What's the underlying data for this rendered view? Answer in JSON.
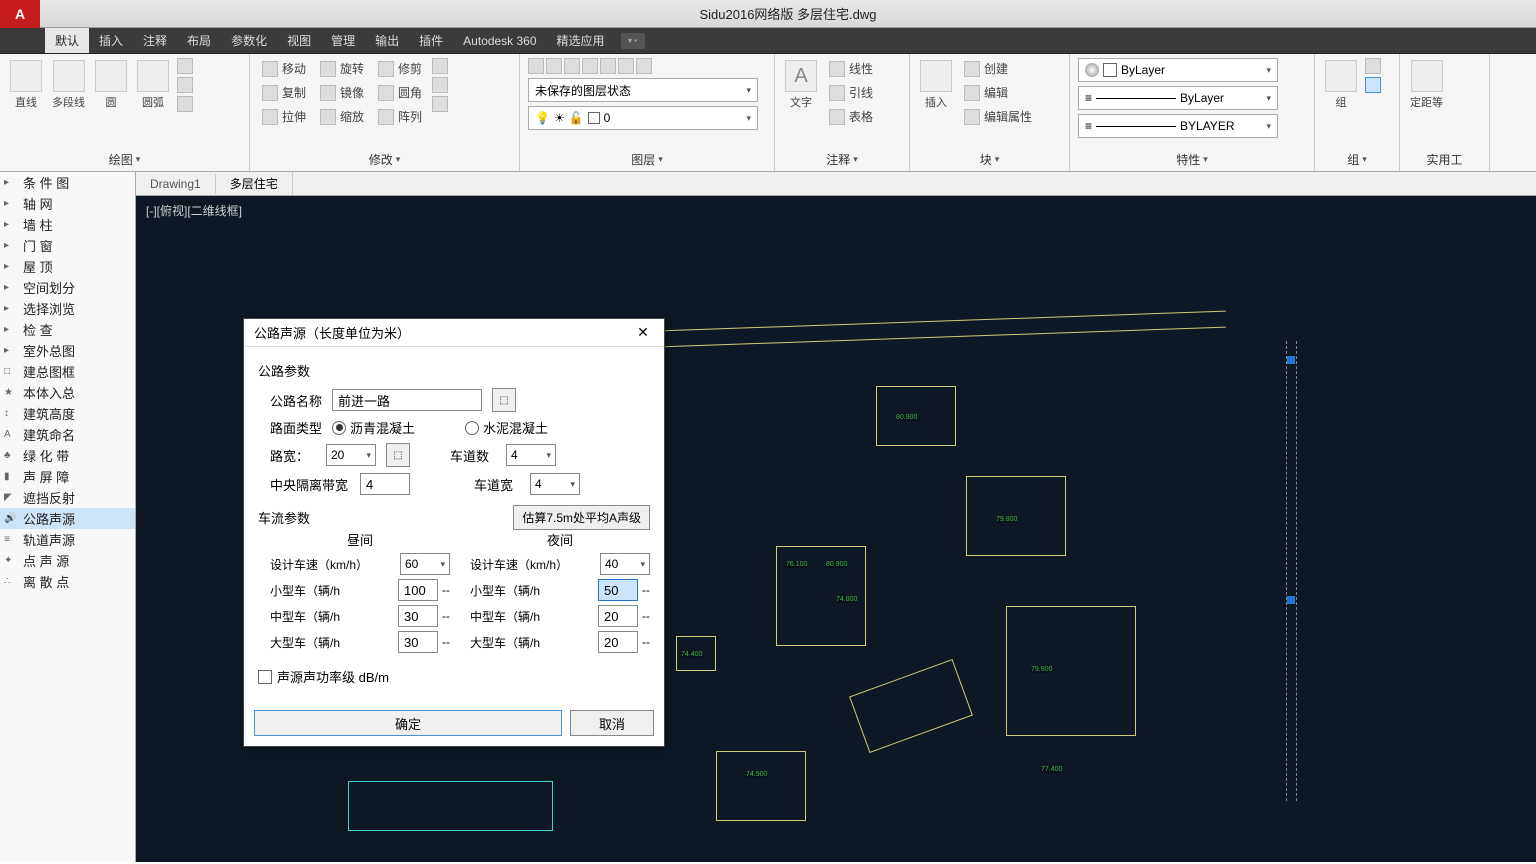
{
  "app": {
    "logo": "A",
    "title": "Sidu2016网络版   多层住宅.dwg"
  },
  "menu": {
    "items": [
      "默认",
      "插入",
      "注释",
      "布局",
      "参数化",
      "视图",
      "管理",
      "输出",
      "插件",
      "Autodesk 360",
      "精选应用"
    ]
  },
  "ribbon": {
    "draw": {
      "label": "绘图",
      "items": [
        "直线",
        "多段线",
        "圆",
        "圆弧"
      ]
    },
    "modify": {
      "label": "修改",
      "items": [
        "移动",
        "旋转",
        "修剪",
        "复制",
        "镜像",
        "圆角",
        "拉伸",
        "缩放",
        "阵列"
      ]
    },
    "layer": {
      "label": "图层",
      "unsaved": "未保存的图层状态",
      "current": "0"
    },
    "annot": {
      "label": "注释",
      "items": [
        "文字",
        "线性",
        "引线",
        "表格"
      ]
    },
    "block": {
      "label": "块",
      "items": [
        "插入",
        "创建",
        "编辑",
        "编辑属性"
      ]
    },
    "props": {
      "label": "特性",
      "bylayer": "ByLayer",
      "bylayer2": "ByLayer",
      "bylayer3": "BYLAYER"
    },
    "group": {
      "label": "组",
      "item": "组"
    },
    "util": {
      "label": "实用工",
      "item": "定距等"
    }
  },
  "sidebar": {
    "items": [
      {
        "ico": "▸",
        "label": "条 件 图"
      },
      {
        "ico": "▸",
        "label": "轴      网"
      },
      {
        "ico": "▸",
        "label": "墙      柱"
      },
      {
        "ico": "▸",
        "label": "门      窗"
      },
      {
        "ico": "▸",
        "label": "屋      顶"
      },
      {
        "ico": "▸",
        "label": "空间划分"
      },
      {
        "ico": "▸",
        "label": "选择浏览"
      },
      {
        "ico": "▸",
        "label": "检      查"
      },
      {
        "ico": "▸",
        "label": "室外总图"
      },
      {
        "ico": "□",
        "label": "建总图框"
      },
      {
        "ico": "★",
        "label": "本体入总"
      },
      {
        "ico": "↕",
        "label": "建筑高度"
      },
      {
        "ico": "A",
        "label": "建筑命名"
      },
      {
        "ico": "♣",
        "label": "绿 化 带"
      },
      {
        "ico": "▮",
        "label": "声 屏 障"
      },
      {
        "ico": "◤",
        "label": "遮挡反射"
      },
      {
        "ico": "🔊",
        "label": "公路声源",
        "sel": true
      },
      {
        "ico": "≡",
        "label": "轨道声源"
      },
      {
        "ico": "✦",
        "label": "点 声 源"
      },
      {
        "ico": "∴",
        "label": "离 散  点"
      }
    ]
  },
  "drawingTabs": {
    "tabs": [
      "Drawing1",
      "多层住宅"
    ],
    "canvasLabel": "[-][俯视][二维线框]"
  },
  "dialog": {
    "title": "公路声源（长度单位为米）",
    "section1": "公路参数",
    "roadName": {
      "label": "公路名称",
      "value": "前进一路"
    },
    "surfaceType": {
      "label": "路面类型",
      "opt1": "沥青混凝土",
      "opt2": "水泥混凝土"
    },
    "width": {
      "label": "路宽：",
      "value": "20"
    },
    "lanes": {
      "label": "车道数",
      "value": "4"
    },
    "median": {
      "label": "中央隔离带宽",
      "value": "4"
    },
    "lanes2": {
      "label": "车道宽",
      "value": "4"
    },
    "section2": "车流参数",
    "estimate": "估算7.5m处平均A声级",
    "day": {
      "title": "昼间",
      "speed": {
        "label": "设计车速（km/h）",
        "value": "60"
      },
      "small": {
        "label": "小型车（辆/h",
        "value": "100",
        "suffix": "--"
      },
      "mid": {
        "label": "中型车（辆/h",
        "value": "30",
        "suffix": "--"
      },
      "big": {
        "label": "大型车（辆/h",
        "value": "30",
        "suffix": "--"
      }
    },
    "night": {
      "title": "夜间",
      "speed": {
        "label": "设计车速（km/h）",
        "value": "40"
      },
      "small": {
        "label": "小型车（辆/h",
        "value": "50",
        "suffix": "--"
      },
      "mid": {
        "label": "中型车（辆/h",
        "value": "20",
        "suffix": "--"
      },
      "big": {
        "label": "大型车（辆/h",
        "value": "20",
        "suffix": "--"
      }
    },
    "checkbox": "声源声功率级 dB/m",
    "ok": "确定",
    "cancel": "取消"
  }
}
